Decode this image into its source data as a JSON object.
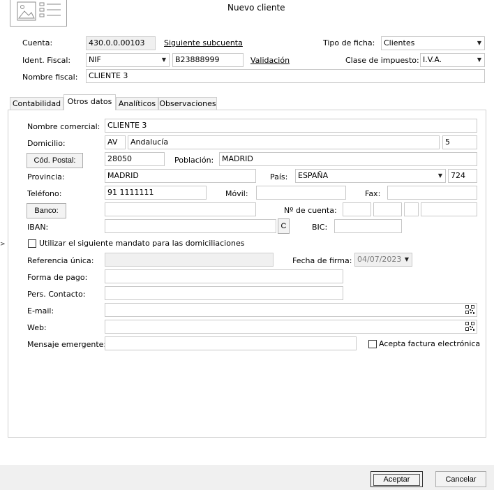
{
  "window": {
    "title": "Nuevo cliente"
  },
  "header": {
    "cuenta_label": "Cuenta:",
    "cuenta_value": "430.0.0.00103",
    "siguiente_link": "Siguiente subcuenta",
    "tipo_ficha_label": "Tipo de ficha:",
    "tipo_ficha_value": "Clientes",
    "ident_fiscal_label": "Ident. Fiscal:",
    "ident_fiscal_type": "NIF",
    "ident_fiscal_value": "B23888999",
    "validacion_link": "Validación",
    "clase_impuesto_label": "Clase de impuesto:",
    "clase_impuesto_value": "I.V.A.",
    "nombre_fiscal_label": "Nombre fiscal:",
    "nombre_fiscal_value": "CLIENTE 3"
  },
  "tabs": [
    {
      "label": "Contabilidad",
      "active": false
    },
    {
      "label": "Otros datos",
      "active": true
    },
    {
      "label": "Analíticos",
      "active": false
    },
    {
      "label": "Observaciones",
      "active": false
    }
  ],
  "form": {
    "nombre_comercial_label": "Nombre comercial:",
    "nombre_comercial_value": "CLIENTE 3",
    "domicilio_label": "Domicilio:",
    "domicilio_tipo": "AV",
    "domicilio_calle": "Andalucía",
    "domicilio_numero": "5",
    "cod_postal_button": "Cód. Postal:",
    "cod_postal_value": "28050",
    "poblacion_label": "Población:",
    "poblacion_value": "MADRID",
    "provincia_label": "Provincia:",
    "provincia_value": "MADRID",
    "pais_label": "País:",
    "pais_value": "ESPAÑA",
    "pais_code": "724",
    "telefono_label": "Teléfono:",
    "telefono_value": "91 1111111",
    "movil_label": "Móvil:",
    "movil_value": "",
    "fax_label": "Fax:",
    "fax_value": "",
    "banco_button": "Banco:",
    "banco_value": "",
    "num_cuenta_label": "Nº de cuenta:",
    "iban_label": "IBAN:",
    "iban_value": "",
    "iban_c_button": "C",
    "bic_label": "BIC:",
    "bic_value": "",
    "mandato_label": "Utilizar el siguiente mandato para las domiciliaciones",
    "mandato_checked": false,
    "referencia_label": "Referencia única:",
    "referencia_value": "",
    "fecha_firma_label": "Fecha de firma:",
    "fecha_firma_value": "04/07/2023",
    "forma_pago_label": "Forma de pago:",
    "forma_pago_value": "",
    "pers_contacto_label": "Pers. Contacto:",
    "pers_contacto_value": "",
    "email_label": "E-mail:",
    "email_value": "",
    "web_label": "Web:",
    "web_value": "",
    "mensaje_label": "Mensaje emergente:",
    "mensaje_value": "",
    "factura_electronica_label": "Acepta factura electrónica",
    "factura_electronica_checked": false
  },
  "footer": {
    "accept_label": "Aceptar",
    "cancel_label": "Cancelar"
  },
  "icons": {
    "image_placeholder": "image-card-icon",
    "qr": "qr-code-icon",
    "dropdown": "chevron-down-icon",
    "side_arrow": "chevron-right-icon"
  }
}
